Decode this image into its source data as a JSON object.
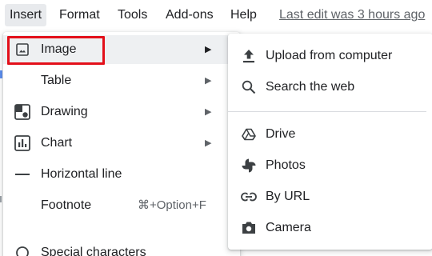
{
  "menubar": {
    "items": [
      "Insert",
      "Format",
      "Tools",
      "Add-ons",
      "Help"
    ],
    "active": "Insert",
    "last_edit": "Last edit was 3 hours ago"
  },
  "insert_menu": {
    "items": [
      {
        "label": "Image",
        "icon": "image-icon",
        "has_submenu": true,
        "highlighted": true
      },
      {
        "label": "Table",
        "icon": "",
        "has_submenu": true
      },
      {
        "label": "Drawing",
        "icon": "drawing-icon",
        "has_submenu": true
      },
      {
        "label": "Chart",
        "icon": "chart-icon",
        "has_submenu": true
      },
      {
        "label": "Horizontal line",
        "icon": "horizontal-line-icon",
        "has_submenu": false
      },
      {
        "label": "Footnote",
        "icon": "",
        "shortcut": "⌘+Option+F",
        "has_submenu": false
      },
      {
        "label": "Special characters",
        "icon": "special-characters-icon",
        "has_submenu": false
      }
    ]
  },
  "image_submenu": {
    "items": [
      {
        "label": "Upload from computer",
        "icon": "upload-icon"
      },
      {
        "label": "Search the web",
        "icon": "search-icon"
      },
      {
        "label": "Drive",
        "icon": "drive-icon"
      },
      {
        "label": "Photos",
        "icon": "photos-icon"
      },
      {
        "label": "By URL",
        "icon": "link-icon"
      },
      {
        "label": "Camera",
        "icon": "camera-icon"
      }
    ]
  },
  "colors": {
    "highlight_border": "#e3101a",
    "active_menu_bg": "#e8eaed",
    "hover_item_bg": "#eef0f2"
  }
}
